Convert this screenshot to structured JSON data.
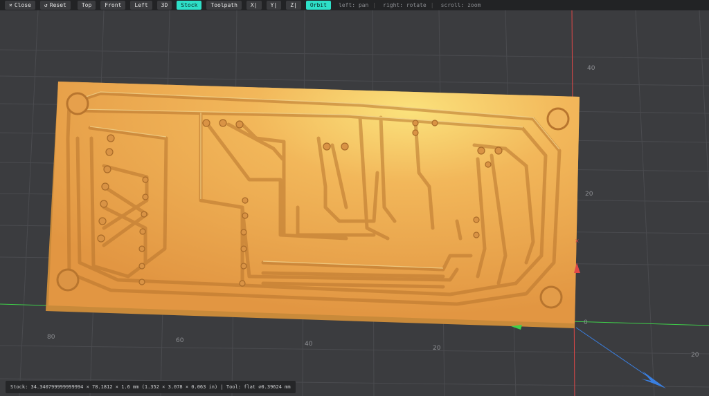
{
  "toolbar": {
    "close": "Close",
    "reset": "Reset",
    "views": [
      "Top",
      "Front",
      "Left",
      "3D"
    ],
    "stock": "Stock",
    "toolpath": "Toolpath",
    "axes": [
      "X|",
      "Y|",
      "Z|"
    ],
    "orbit": "Orbit",
    "hints": [
      "left: pan",
      "right: rotate",
      "scroll: zoom"
    ]
  },
  "axis_labels": {
    "y_ticks": [
      "40",
      "20",
      "0"
    ],
    "x_ticks": [
      "80",
      "60",
      "40",
      "20",
      "20"
    ]
  },
  "status": "Stock: 34.340799999999994 × 78.1812 × 1.6 mm (1.352 × 3.078 × 0.063 in) | Tool: flat ⌀0.39624 mm",
  "colors": {
    "background": "#3b3c3f",
    "accent": "#2ee0c8",
    "stock": "#e8a24d",
    "axis_x": "#e04848",
    "axis_y": "#3fd04a",
    "axis_z": "#3a7fe0"
  },
  "icons": {
    "close": "close-icon",
    "reset": "reset-icon"
  }
}
